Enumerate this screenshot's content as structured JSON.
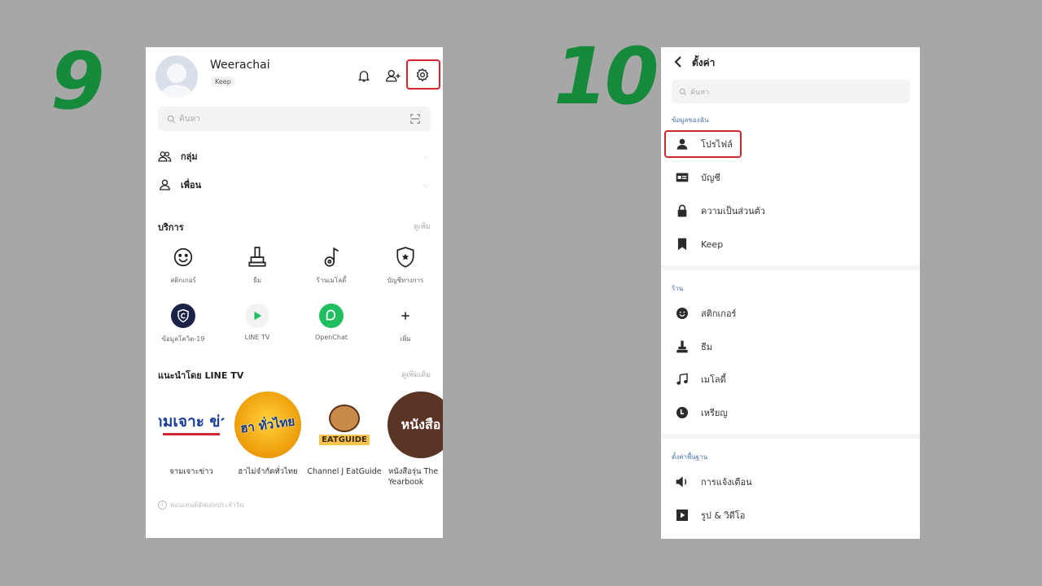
{
  "steps": {
    "left": "9",
    "right": "10"
  },
  "home": {
    "username": "Weerachai",
    "status_pill": "Keep",
    "search_placeholder": "ค้นหา",
    "rows": [
      {
        "label": "กลุ่ม",
        "icon": "group-icon"
      },
      {
        "label": "เพื่อน",
        "icon": "friend-icon"
      }
    ],
    "services_title": "บริการ",
    "services_more": "ดูเพิ่ม",
    "services": [
      {
        "label": "สติกเกอร์",
        "icon": "smile-icon"
      },
      {
        "label": "ธีม",
        "icon": "theme-brush-icon"
      },
      {
        "label": "ร้านเมโลดี้",
        "icon": "melody-note-icon"
      },
      {
        "label": "บัญชีทางการ",
        "icon": "official-shield-icon"
      },
      {
        "label": "ข้อมูลโควิด-19",
        "icon": "covid-info-icon"
      },
      {
        "label": "LINE TV",
        "icon": "line-tv-play-icon"
      },
      {
        "label": "OpenChat",
        "icon": "openchat-icon"
      },
      {
        "label": "เพิ่ม",
        "icon": "plus-icon"
      }
    ],
    "linetv_title": "แนะนำโดย LINE TV",
    "linetv_more": "ดูเพิ่มเติม",
    "shows": [
      {
        "label": "จามเจาะข่าว",
        "art": "จามเจาะ ข่าว"
      },
      {
        "label": "ฮาไม่จำกัดทั่วไทย",
        "art": "ฮา ทั่วไทย"
      },
      {
        "label": "Channel J EatGuide",
        "art": "EATGUIDE"
      },
      {
        "label": "หนังสือรุ่น The Yearbook",
        "art": "หนังสือ"
      }
    ],
    "footer_note": "คอนเทนต์อัพเดทประจำวัน",
    "colors": {
      "highlight": "#d0262e",
      "step_number": "#148a3a"
    }
  },
  "settings": {
    "title": "ตั้งค่า",
    "search_placeholder": "ค้นหา",
    "sections": [
      {
        "title": "ข้อมูลของฉัน",
        "items": [
          {
            "label": "โปรไฟล์",
            "icon": "person-icon"
          },
          {
            "label": "บัญชี",
            "icon": "account-card-icon"
          },
          {
            "label": "ความเป็นส่วนตัว",
            "icon": "lock-icon"
          },
          {
            "label": "Keep",
            "icon": "bookmark-icon"
          }
        ]
      },
      {
        "title": "ร้าน",
        "items": [
          {
            "label": "สติกเกอร์",
            "icon": "smile-icon"
          },
          {
            "label": "ธีม",
            "icon": "theme-brush-icon"
          },
          {
            "label": "เมโลดี้",
            "icon": "music-note-icon"
          },
          {
            "label": "เหรียญ",
            "icon": "coin-icon"
          }
        ]
      },
      {
        "title": "ตั้งค่าพื้นฐาน",
        "items": [
          {
            "label": "การแจ้งเตือน",
            "icon": "speaker-icon"
          },
          {
            "label": "รูป & วิดีโอ",
            "icon": "video-icon"
          }
        ]
      }
    ]
  }
}
